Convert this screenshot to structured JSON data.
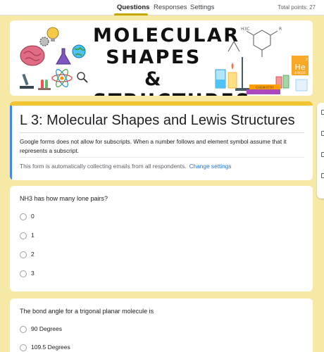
{
  "tabs": [
    {
      "label": "Questions"
    },
    {
      "label": "Responses"
    },
    {
      "label": "Settings"
    }
  ],
  "total_points": "Total points: 27",
  "banner": {
    "title": "MOLECULAR SHAPES & STRUCTURES",
    "element_symbol": "He",
    "element_number": "2",
    "element_mass": "4.0026",
    "book_label": "CHEMISTRY",
    "formula_label_1": "H3C",
    "formula_label_2": "R"
  },
  "form": {
    "title": "L 3: Molecular Shapes and Lewis Structures",
    "description": "Google forms does not allow for subscripts. When a number follows and element symbol assume that it represents a subscript.",
    "email_note": "This form is automatically collecting emails from all respondents.",
    "change_settings": "Change settings"
  },
  "questions": [
    {
      "title": "NH3 has how many lone pairs?",
      "options": [
        "0",
        "1",
        "2",
        "3"
      ]
    },
    {
      "title": "The bond angle for a trigonal planar molecule is",
      "options": [
        "90 Degrees",
        "109.5 Degrees"
      ]
    }
  ],
  "colors": {
    "background": "#f6e9a6",
    "accent": "#f1c232",
    "link": "#1a73e8",
    "title_strip": "#4285f4"
  }
}
